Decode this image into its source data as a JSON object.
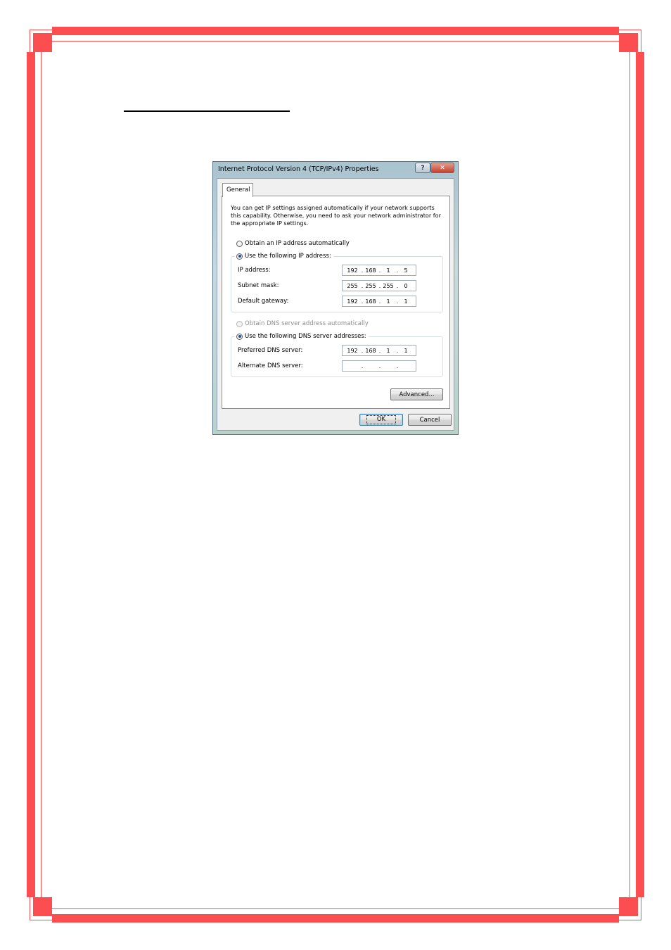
{
  "dialog": {
    "title": "Internet Protocol Version 4 (TCP/IPv4) Properties",
    "help_label": "?",
    "close_label": "✕",
    "tab_general": "General",
    "description": "You can get IP settings assigned automatically if your network supports this capability. Otherwise, you need to ask your network administrator for the appropriate IP settings.",
    "ip_section": {
      "obtain_auto_label": "Obtain an IP address automatically",
      "use_following_label": "Use the following IP address:",
      "selected": "use_following",
      "fields": [
        {
          "label": "IP address:",
          "octets": [
            "192",
            "168",
            "1",
            "5"
          ]
        },
        {
          "label": "Subnet mask:",
          "octets": [
            "255",
            "255",
            "255",
            "0"
          ]
        },
        {
          "label": "Default gateway:",
          "octets": [
            "192",
            "168",
            "1",
            "1"
          ]
        }
      ]
    },
    "dns_section": {
      "obtain_auto_label": "Obtain DNS server address automatically",
      "use_following_label": "Use the following DNS server addresses:",
      "selected": "use_following",
      "fields": [
        {
          "label": "Preferred DNS server:",
          "octets": [
            "192",
            "168",
            "1",
            "1"
          ]
        },
        {
          "label": "Alternate DNS server:",
          "octets": [
            "",
            "",
            "",
            ""
          ]
        }
      ]
    },
    "advanced_label": "Advanced...",
    "ok_label": "OK",
    "cancel_label": "Cancel"
  },
  "colors": {
    "page_border": "#fc4e50",
    "dialog_frame": "#b9d2c9",
    "radio_dot": "#1f4f8f"
  }
}
